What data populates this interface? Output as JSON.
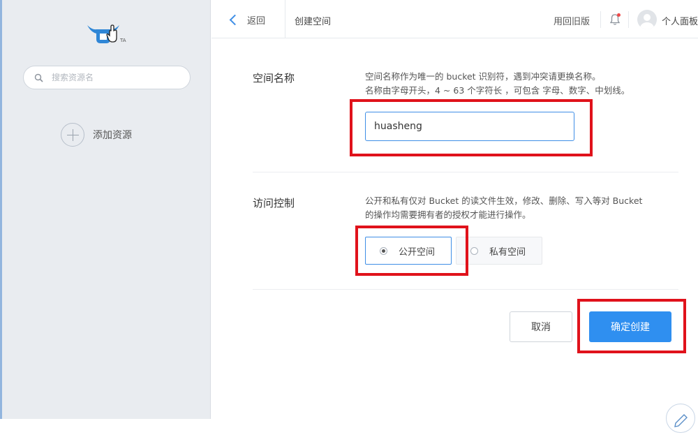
{
  "sidebar": {
    "search": {
      "placeholder": "搜索资源名"
    },
    "add_resource_label": "添加资源"
  },
  "topbar": {
    "back_label": "返回",
    "page_title": "创建空间",
    "old_version_label": "用回旧版",
    "user_label": "个人面板"
  },
  "form": {
    "space_name": {
      "label": "空间名称",
      "desc_line1": "空间名称作为唯一的 bucket 识别符，遇到冲突请更换名称。",
      "desc_line2": "名称由字母开头，4 ~ 63 个字符长 ，可包含 字母、数字、中划线。",
      "value": "huasheng"
    },
    "access_control": {
      "label": "访问控制",
      "desc_line1": "公开和私有仅对 Bucket 的读文件生效，修改、删除、写入等对 Bucket",
      "desc_line2": "的操作均需要拥有者的授权才能进行操作。",
      "options": [
        {
          "label": "公开空间",
          "selected": true
        },
        {
          "label": "私有空间",
          "selected": false
        }
      ]
    }
  },
  "actions": {
    "cancel_label": "取消",
    "confirm_label": "确定创建"
  },
  "colors": {
    "accent": "#2f8ff0",
    "highlight_box": "#e0121b",
    "sidebar_bg": "#e9ecf0",
    "notification_dot": "#f04848"
  },
  "icons": {
    "logo": "bull-head-logo",
    "search": "search-icon",
    "add": "plus-circle-icon",
    "back": "chevron-left-icon",
    "notification": "bell-icon",
    "avatar": "user-avatar-icon",
    "edit": "pencil-icon"
  }
}
